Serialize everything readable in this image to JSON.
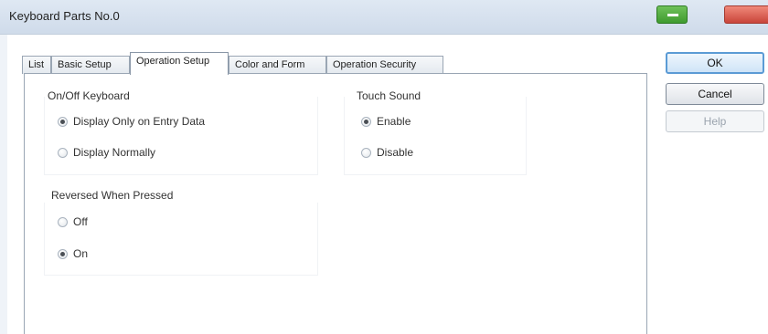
{
  "window": {
    "title": "Keyboard Parts No.0"
  },
  "tabs": [
    {
      "label": "List",
      "active": false
    },
    {
      "label": "Basic Setup",
      "active": false
    },
    {
      "label": "Operation Setup",
      "active": true
    },
    {
      "label": "Color and Form",
      "active": false
    },
    {
      "label": "Operation Security",
      "active": false
    }
  ],
  "onoff_keyboard": {
    "label": "On/Off Keyboard",
    "options": [
      {
        "label": "Display Only on Entry Data",
        "checked": true
      },
      {
        "label": "Display Normally",
        "checked": false
      }
    ]
  },
  "touch_sound": {
    "label": "Touch Sound",
    "options": [
      {
        "label": "Enable",
        "checked": true
      },
      {
        "label": "Disable",
        "checked": false
      }
    ]
  },
  "reversed_when_pressed": {
    "label": "Reversed When Pressed",
    "options": [
      {
        "label": "Off",
        "checked": false
      },
      {
        "label": "On",
        "checked": true
      }
    ]
  },
  "buttons": {
    "ok": "OK",
    "cancel": "Cancel",
    "help": "Help"
  }
}
